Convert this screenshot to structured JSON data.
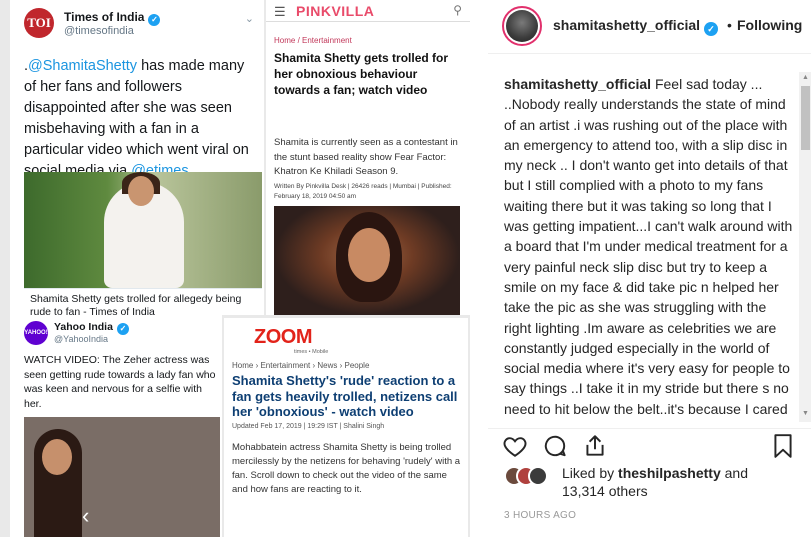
{
  "toi": {
    "logo": "TOI",
    "name": "Times of India",
    "handle": "@timesofindia",
    "tweet_pre": ".",
    "tweet_mention": "@ShamitaShetty",
    "tweet_body": " has made many of her fans and followers disappointed after she was seen misbehaving with a fan in a particular video which went viral on social media via ",
    "tweet_via": "@etimes",
    "photo_caption": "Shamita Shetty gets trolled for allegedy being rude to fan - Times of India"
  },
  "pinkvilla": {
    "brand": "PINKVILLA",
    "crumb": "Home / Entertainment",
    "headline": "Shamita Shetty gets trolled for her obnoxious behaviour towards a fan; watch video",
    "desc": "Shamita is currently seen as a contestant in the stunt based reality show Fear Factor: Khatron Ke Khiladi Season 9.",
    "meta": "Written By Pinkvilla Desk | 26426 reads | Mumbai | Published: February 18, 2019 04:50 am"
  },
  "yahoo": {
    "logo": "YAHOO! INDIA",
    "name": "Yahoo India",
    "handle": "@YahooIndia",
    "tweet": "WATCH VIDEO: The Zeher actress was seen getting rude towards a lady fan who was keen and nervous for a selfie with her."
  },
  "zoom": {
    "logo": "ZOOM",
    "tag": "times • Mobile",
    "crumb": "Home › Entertainment › News › People",
    "headline": "Shamita Shetty's 'rude' reaction to a fan gets heavily trolled, netizens call her 'obnoxious' - watch video",
    "meta": "Updated Feb 17, 2019 | 19:29 IST | Shalini Singh",
    "desc": "Mohabbatein actress Shamita Shetty is being trolled mercilessly by the netizens for behaving 'rudely' with a fan. Scroll down to check out the video of the same and how fans are reacting to it."
  },
  "instagram": {
    "username": "shamitashetty_official",
    "separator": "•",
    "follow_status": "Following",
    "caption_user": "shamitashetty_official",
    "caption_text": " Feel sad today ... ..Nobody really understands the state of mind of an artist .i was rushing out of the place with an emergency to attend too, with a slip disc in my neck .. I don't wanto get into details of that but I still complied with a photo to my fans waiting there but it was taking so long that I was getting impatient...I can't walk around with a board that I'm under medical treatment for a very painful neck slip disc but try to keep a smile on my face & did take pic n helped her take the pic as she was struggling with the right lighting .Im aware as celebrities we are constantly judged especially in the world of social media where it's very easy for people to say things ..I take it in my stride but there s no need to hit below the belt..it's because I cared that I still took",
    "liked_by_prefix": "Liked by ",
    "liked_by_user": "theshilpashetty",
    "liked_by_and": " and",
    "others": "13,314 others",
    "timestamp": "3 HOURS AGO",
    "icons": [
      "heart-icon",
      "comment-icon",
      "share-icon",
      "bookmark-icon",
      "verified-icon"
    ]
  },
  "colors": {
    "twitter_blue": "#1b95e0",
    "toi_red": "#c0272d",
    "pinkvilla_pink": "#e94b6a",
    "zoom_red": "#e2231a",
    "zoom_headline": "#0e3f73",
    "ig_text": "#262626",
    "ig_muted": "#999999"
  }
}
